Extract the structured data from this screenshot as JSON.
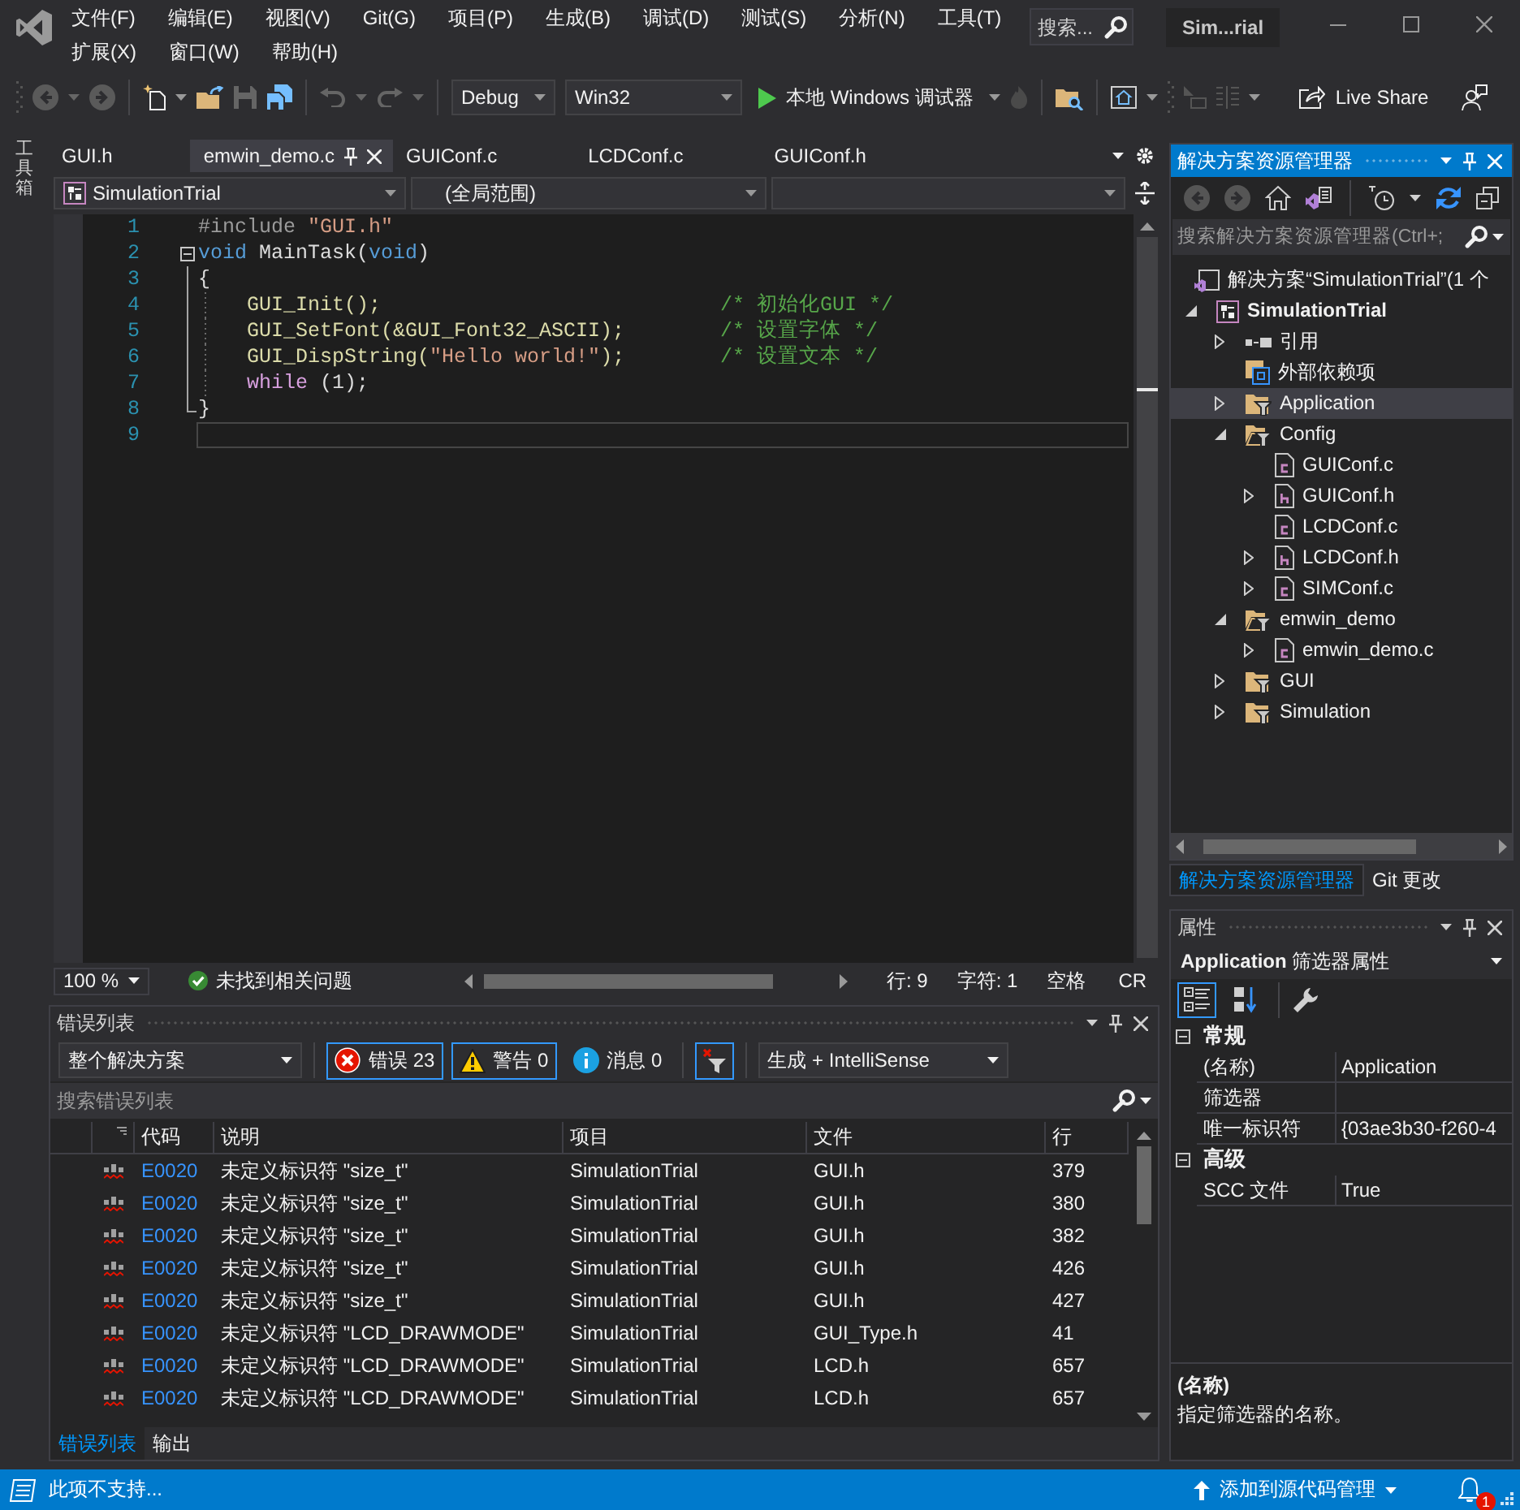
{
  "window": {
    "title": "Sim...rial",
    "search_placeholder": "搜索..."
  },
  "menu": [
    "文件(F)",
    "编辑(E)",
    "视图(V)",
    "Git(G)",
    "项目(P)",
    "生成(B)",
    "调试(D)",
    "测试(S)",
    "分析(N)",
    "工具(T)",
    "扩展(X)",
    "窗口(W)",
    "帮助(H)"
  ],
  "toolbar": {
    "configuration": "Debug",
    "platform": "Win32",
    "debug_target": "本地 Windows 调试器",
    "live_share": "Live Share"
  },
  "toolbox": {
    "label": "工具箱"
  },
  "editor": {
    "tabs": [
      {
        "label": "GUI.h",
        "selected": false
      },
      {
        "label": "emwin_demo.c",
        "selected": true
      },
      {
        "label": "GUIConf.c",
        "selected": false
      },
      {
        "label": "LCDConf.c",
        "selected": false
      },
      {
        "label": "GUIConf.h",
        "selected": false
      }
    ],
    "navigation": {
      "project": "SimulationTrial",
      "scope": "(全局范围)"
    },
    "lines": [
      {
        "number": "1",
        "tokens": [
          {
            "kind": "preprocessor",
            "text": "#include "
          },
          {
            "kind": "string",
            "text": "\"GUI.h\""
          }
        ]
      },
      {
        "number": "2",
        "expanded": true,
        "tokens": [
          {
            "kind": "keyword",
            "text": "void"
          },
          {
            "kind": "plain",
            "text": " MainTask("
          },
          {
            "kind": "keyword",
            "text": "void"
          },
          {
            "kind": "plain",
            "text": ")"
          }
        ],
        "children": [
          {
            "number": "3",
            "tokens": [
              {
                "kind": "plain",
                "text": "{"
              }
            ],
            "children": [
              {
                "number": "4",
                "tokens": [
                  {
                    "kind": "function",
                    "text": "GUI_Init();"
                  }
                ],
                "comment": "/* 初始化GUI */"
              },
              {
                "number": "5",
                "tokens": [
                  {
                    "kind": "function",
                    "text": "GUI_SetFont(&GUI_Font32_ASCII);"
                  }
                ],
                "comment": "/* 设置字体 */"
              },
              {
                "number": "6",
                "tokens": [
                  {
                    "kind": "function",
                    "text": "GUI_DispString("
                  },
                  {
                    "kind": "string",
                    "text": "\"Hello world!\""
                  },
                  {
                    "kind": "function",
                    "text": ");"
                  }
                ],
                "comment": "/* 设置文本 */"
              },
              {
                "number": "7",
                "tokens": [
                  {
                    "kind": "control",
                    "text": "while"
                  },
                  {
                    "kind": "plain",
                    "text": " (1);"
                  }
                ]
              }
            ]
          },
          {
            "number": "8",
            "tokens": [
              {
                "kind": "plain",
                "text": "}"
              }
            ]
          }
        ]
      },
      {
        "number": "9",
        "current": true
      }
    ],
    "status": {
      "zoom": "100 %",
      "issues": "未找到相关问题",
      "line": "行: 9",
      "character": "字符: 1",
      "whitespace": "空格",
      "line_ending": "CR"
    }
  },
  "error_list": {
    "title": "错误列表",
    "active": false,
    "scope": "整个解决方案",
    "filters": [
      {
        "kind": "error",
        "label": "错误 23",
        "on": true
      },
      {
        "kind": "warning",
        "label": "警告 0",
        "on": true
      },
      {
        "kind": "message",
        "label": "消息 0",
        "on": false
      }
    ],
    "filter_toggle": {
      "on": true
    },
    "source": "生成 + IntelliSense",
    "search_placeholder": "搜索错误列表",
    "columns": [
      "代码",
      "说明",
      "项目",
      "文件",
      "行"
    ],
    "rows": [
      {
        "code": "E0020",
        "description": "未定义标识符 \"size_t\"",
        "project": "SimulationTrial",
        "file": "GUI.h",
        "line": "379"
      },
      {
        "code": "E0020",
        "description": "未定义标识符 \"size_t\"",
        "project": "SimulationTrial",
        "file": "GUI.h",
        "line": "380"
      },
      {
        "code": "E0020",
        "description": "未定义标识符 \"size_t\"",
        "project": "SimulationTrial",
        "file": "GUI.h",
        "line": "382"
      },
      {
        "code": "E0020",
        "description": "未定义标识符 \"size_t\"",
        "project": "SimulationTrial",
        "file": "GUI.h",
        "line": "426"
      },
      {
        "code": "E0020",
        "description": "未定义标识符 \"size_t\"",
        "project": "SimulationTrial",
        "file": "GUI.h",
        "line": "427"
      },
      {
        "code": "E0020",
        "description": "未定义标识符 \"LCD_DRAWMODE\"",
        "project": "SimulationTrial",
        "file": "GUI_Type.h",
        "line": "41"
      },
      {
        "code": "E0020",
        "description": "未定义标识符 \"LCD_DRAWMODE\"",
        "project": "SimulationTrial",
        "file": "LCD.h",
        "line": "657"
      },
      {
        "code": "E0020",
        "description": "未定义标识符 \"LCD_DRAWMODE\"",
        "project": "SimulationTrial",
        "file": "LCD.h",
        "line": "657"
      }
    ],
    "tabs": [
      {
        "label": "错误列表",
        "selected": true
      },
      {
        "label": "输出",
        "selected": false
      }
    ]
  },
  "solution_explorer": {
    "title": "解决方案资源管理器",
    "active": true,
    "search_placeholder": "搜索解决方案资源管理器(Ctrl+;",
    "tree": [
      {
        "label": "解决方案“SimulationTrial”(1 个",
        "kind": "solution",
        "selected": false,
        "children": [
          {
            "label": "SimulationTrial",
            "kind": "project",
            "selected": false,
            "expanded": true,
            "children": [
              {
                "label": "引用",
                "kind": "references",
                "selected": false,
                "expanded": false
              },
              {
                "label": "外部依赖项",
                "kind": "dependencies",
                "selected": false
              },
              {
                "label": "Application",
                "kind": "filter",
                "selected": true,
                "expanded": false
              },
              {
                "label": "Config",
                "kind": "filter",
                "selected": false,
                "expanded": true,
                "children": [
                  {
                    "label": "GUIConf.c",
                    "kind": "c-file",
                    "selected": false
                  },
                  {
                    "label": "GUIConf.h",
                    "kind": "h-file",
                    "selected": false,
                    "expanded": false
                  },
                  {
                    "label": "LCDConf.c",
                    "kind": "c-file",
                    "selected": false
                  },
                  {
                    "label": "LCDConf.h",
                    "kind": "h-file",
                    "selected": false,
                    "expanded": false
                  },
                  {
                    "label": "SIMConf.c",
                    "kind": "c-file",
                    "selected": false,
                    "expanded": false
                  }
                ]
              },
              {
                "label": "emwin_demo",
                "kind": "filter",
                "selected": false,
                "expanded": true,
                "children": [
                  {
                    "label": "emwin_demo.c",
                    "kind": "c-file",
                    "selected": false,
                    "expanded": false
                  }
                ]
              },
              {
                "label": "GUI",
                "kind": "filter",
                "selected": false,
                "expanded": false
              },
              {
                "label": "Simulation",
                "kind": "filter",
                "selected": false,
                "expanded": false
              }
            ]
          }
        ]
      }
    ],
    "tabs": [
      {
        "label": "解决方案资源管理器",
        "selected": true
      },
      {
        "label": "Git 更改",
        "selected": false
      }
    ]
  },
  "properties": {
    "title": "属性",
    "active": false,
    "object": "**Application** 筛选器属性",
    "views": [
      {
        "kind": "categorized",
        "selected": true
      },
      {
        "kind": "alphabetical",
        "selected": false
      }
    ],
    "categories": [
      {
        "name": "常规",
        "expanded": true,
        "rows": [
          {
            "name": "(名称)",
            "value": "Application"
          },
          {
            "name": "筛选器"
          },
          {
            "name": "唯一标识符",
            "value": "{03ae3b30-f260-4"
          }
        ]
      },
      {
        "name": "高级",
        "expanded": true,
        "rows": [
          {
            "name": "SCC 文件",
            "value": "True"
          }
        ]
      }
    ],
    "description": {
      "title": "(名称)",
      "text": "指定筛选器的名称。"
    }
  },
  "status_bar": {
    "message": "此项不支持...",
    "source_control": "添加到源代码管理",
    "notifications": "1"
  }
}
